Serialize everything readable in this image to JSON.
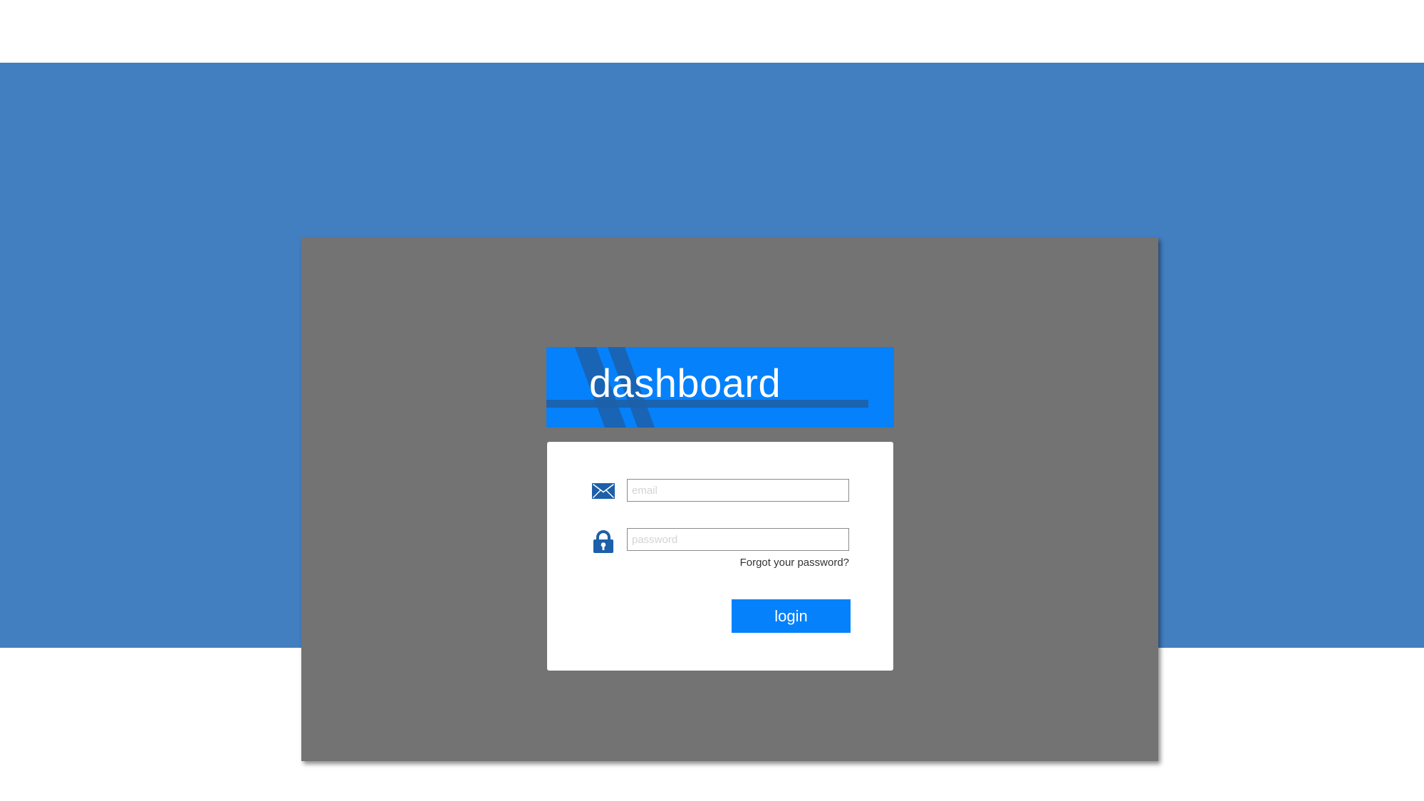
{
  "header": {
    "title": "dashboard"
  },
  "login_form": {
    "email_placeholder": "email",
    "email_value": "",
    "password_placeholder": "password",
    "password_value": "",
    "forgot_password_label": "Forgot your password?",
    "login_label": "login"
  },
  "icons": {
    "email": "envelope-icon",
    "password": "lock-icon"
  },
  "colors": {
    "band_blue": "#427fc1",
    "panel_gray": "#737373",
    "accent_blue": "#0581fb",
    "icon_dark_blue": "#1d5fa8"
  }
}
